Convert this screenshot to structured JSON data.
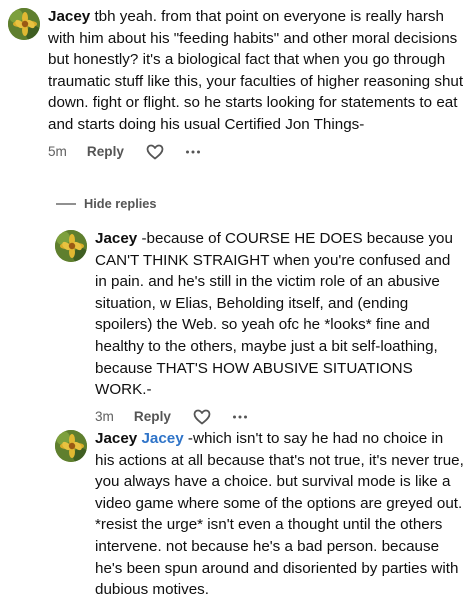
{
  "comments": [
    {
      "author": "Jacey",
      "mention": "",
      "body": " tbh yeah. from that point on everyone is really harsh with him about his \"feeding habits\" and other moral decisions but honestly? it's a biological fact that when you go through traumatic stuff like this, your faculties of higher reasoning shut down. fight or flight. so he starts looking for statements to eat and starts doing his usual Certified Jon Things-",
      "time": "5m",
      "reply_label": "Reply"
    },
    {
      "author": "Jacey",
      "mention": "",
      "body": " -because of COURSE HE DOES because you CAN'T THINK STRAIGHT when you're confused and in pain. and he's still in the victim role of an abusive situation, w Elias, Beholding itself, and (ending spoilers) the Web. so yeah ofc he *looks* fine and healthy to the others, maybe just a bit self-loathing, because THAT'S HOW ABUSIVE SITUATIONS WORK.-",
      "time": "3m",
      "reply_label": "Reply"
    },
    {
      "author": "Jacey",
      "mention": "Jacey",
      "body": " -which isn't to say he had no choice in his actions at all because that's not true, it's never true, you always have a choice. but survival mode is like a video game where some of the options are greyed out. *resist the urge* isn't even a thought until the others intervene. not because he's a bad person. because he's been spun around and disoriented by parties with dubious motives."
    }
  ],
  "hide_replies_label": "Hide replies",
  "icons": {
    "like": "heart-outline-icon",
    "more": "more-horizontal-icon",
    "avatar": "flower-avatar"
  },
  "colors": {
    "mention": "#2f74c8",
    "text": "#0f0f0f",
    "meta": "#606060"
  }
}
